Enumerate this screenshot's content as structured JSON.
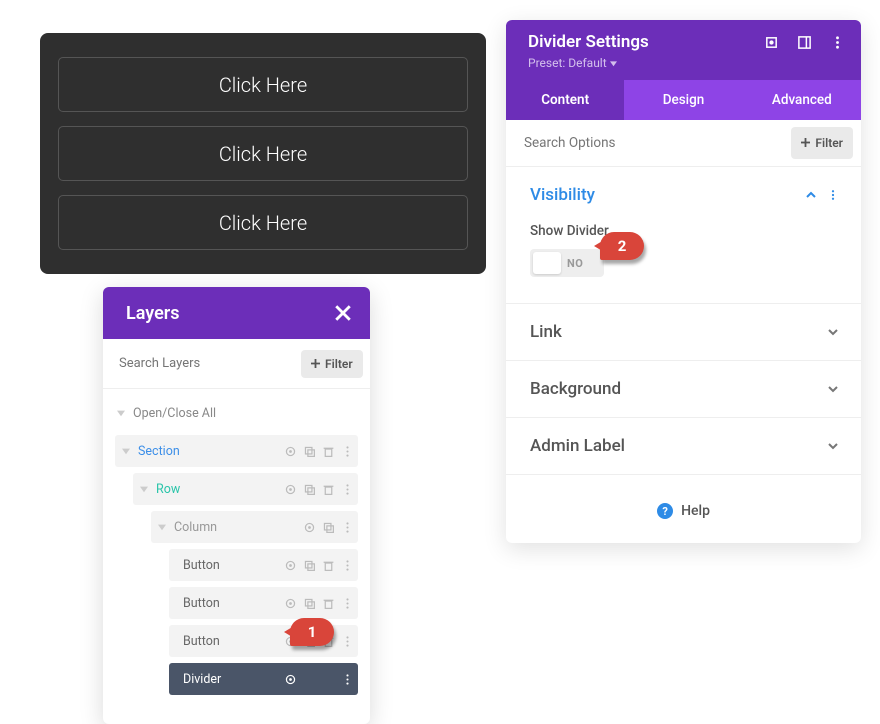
{
  "preview": {
    "buttons": [
      "Click Here",
      "Click Here",
      "Click Here"
    ]
  },
  "layers_panel": {
    "title": "Layers",
    "search_placeholder": "Search Layers",
    "filter_label": "Filter",
    "open_close_all": "Open/Close All",
    "section_label": "Section",
    "row_label": "Row",
    "column_label": "Column",
    "modules": [
      "Button",
      "Button",
      "Button",
      "Divider"
    ]
  },
  "settings_panel": {
    "title": "Divider Settings",
    "preset_label": "Preset: Default",
    "tabs": {
      "content": "Content",
      "design": "Design",
      "advanced": "Advanced"
    },
    "search_placeholder": "Search Options",
    "filter_label": "Filter",
    "sections": {
      "visibility": "Visibility",
      "link": "Link",
      "background": "Background",
      "admin_label": "Admin Label"
    },
    "visibility": {
      "show_divider_label": "Show Divider",
      "toggle_state": "NO"
    },
    "help_label": "Help"
  },
  "annotations": {
    "one": "1",
    "two": "2"
  },
  "colors": {
    "purple_dark": "#6c2eb9",
    "purple_light": "#8e44e6",
    "accent_red": "#d9453a",
    "blue": "#2e8be6",
    "teal": "#29c4a9"
  }
}
